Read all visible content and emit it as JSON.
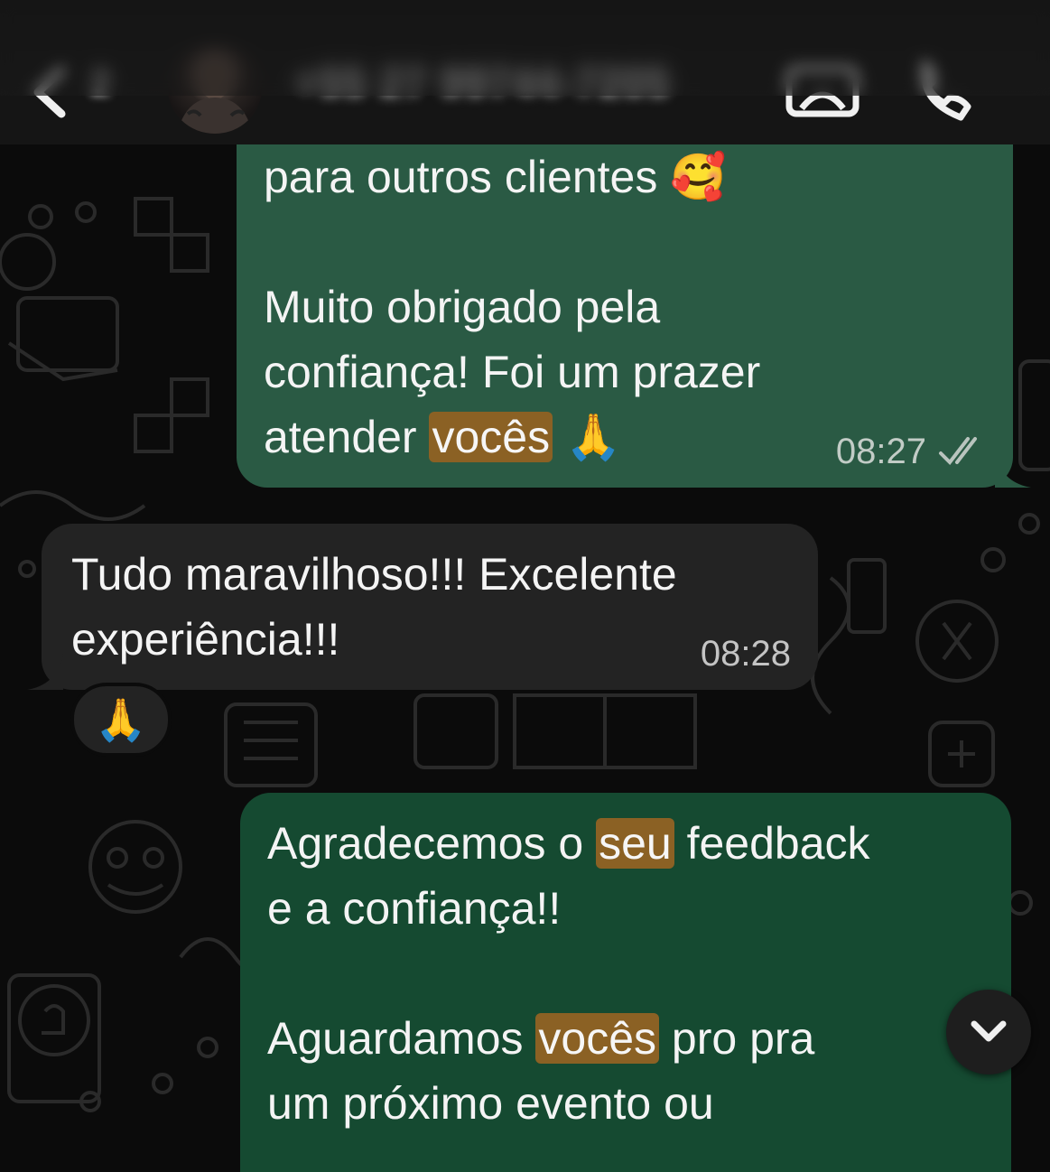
{
  "header": {
    "back_count": "2",
    "contact_name": "+55 27 99744-7205"
  },
  "messages": [
    {
      "direction": "outgoing",
      "lines": [
        "para outros clientes"
      ],
      "emoji": "🥰",
      "second_paragraph": [
        "Muito obrigado pela",
        "confiança! Foi um prazer"
      ],
      "last_line_pre": "atender ",
      "last_line_highlight": "vocês",
      "last_emoji": "🙏",
      "time": "08:27",
      "status": "read"
    },
    {
      "direction": "incoming",
      "line1": "Tudo maravilhoso!!! Excelente",
      "line2": "experiência!!!",
      "time": "08:28",
      "reaction": "🙏"
    },
    {
      "direction": "outgoing",
      "line1_pre": "Agradecemos o ",
      "line1_highlight": "seu",
      "line1_post": " feedback",
      "line2": "e a confiança!!",
      "line3_pre": "Aguardamos ",
      "line3_highlight": "vocês",
      "line3_post": " pro pra",
      "line4": "um próximo evento ou"
    }
  ],
  "icons": {
    "back": "chevron-left-icon",
    "video": "video-camera-icon",
    "call": "phone-icon",
    "scroll": "chevron-down-icon",
    "read_receipt": "double-check-icon"
  },
  "colors": {
    "outgoing_bubble": "#2a5a44",
    "outgoing_bubble_2": "#154a31",
    "incoming_bubble": "#232323",
    "search_highlight": "#8b6124",
    "background": "#0b0b0b"
  }
}
